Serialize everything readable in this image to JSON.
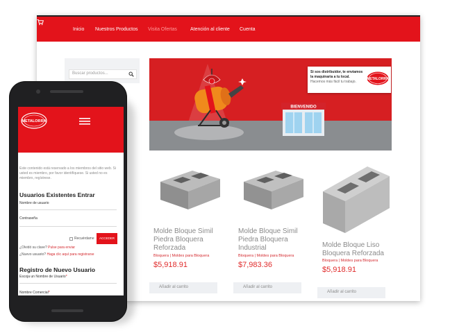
{
  "desktop": {
    "nav": {
      "items": [
        "Inicio",
        "Nuestros Productos",
        "Visita Ofertas",
        "Atención al cliente",
        "Cuenta"
      ],
      "cart_icon": "cart-icon"
    },
    "search": {
      "placeholder": "Buscar productos..."
    },
    "banner": {
      "line1": "Si sos distribuidor, te enviamos",
      "line2": "la maquinaria a tu local.",
      "line3": "Hacemos más fácil tu trabajo.",
      "store_sign": "BIENVENIDO",
      "logo_text": "METALORRA"
    },
    "products": [
      {
        "name": "Molde Bloque Simil Piedra Bloquera Reforzada",
        "category": "Bloquera | Moldes para Bloquera",
        "price": "$5,918.91",
        "button": "Añadir al carrito"
      },
      {
        "name": "Molde Bloque Simil Piedra Bloquera Industrial",
        "category": "Bloquera | Moldes para Bloquera",
        "price": "$7,983.36",
        "button": "Añadir al carrito"
      },
      {
        "name": "Molde Bloque Liso Bloquera Reforzada",
        "category": "Bloquera | Moldes para Bloquera",
        "price": "$5,918.91",
        "button": "Añadir al carrito"
      }
    ]
  },
  "mobile": {
    "logo_text": "METALORRA",
    "intro": "Este contenido está reservado a los miembros del sitio web. Si usted es miembro, por favor identifíquese. Si usted no es miembro, regístrese.",
    "login_title": "Usuarios Existentes Entrar",
    "username_label": "Nombre de usuario",
    "password_label": "Contraseña",
    "remember_label": "Recuérdame",
    "access_button": "ACCEDER",
    "forgot_prefix": "¿Olvidó su clave?",
    "forgot_link": "Pulse para enviar",
    "new_user_prefix": "¿Nuevo usuario?",
    "new_user_link": "Haga clic aquí para registrarse",
    "register_title": "Registro de Nuevo Usuario",
    "register_username_label": "Escoja un Nombre de Usuario",
    "commercial_name_label": "Nombre Comercial",
    "required_mark": "*"
  },
  "colors": {
    "brand_red": "#e3131b",
    "text_gray": "#8a8a8a",
    "link_red": "#d42a2f"
  }
}
